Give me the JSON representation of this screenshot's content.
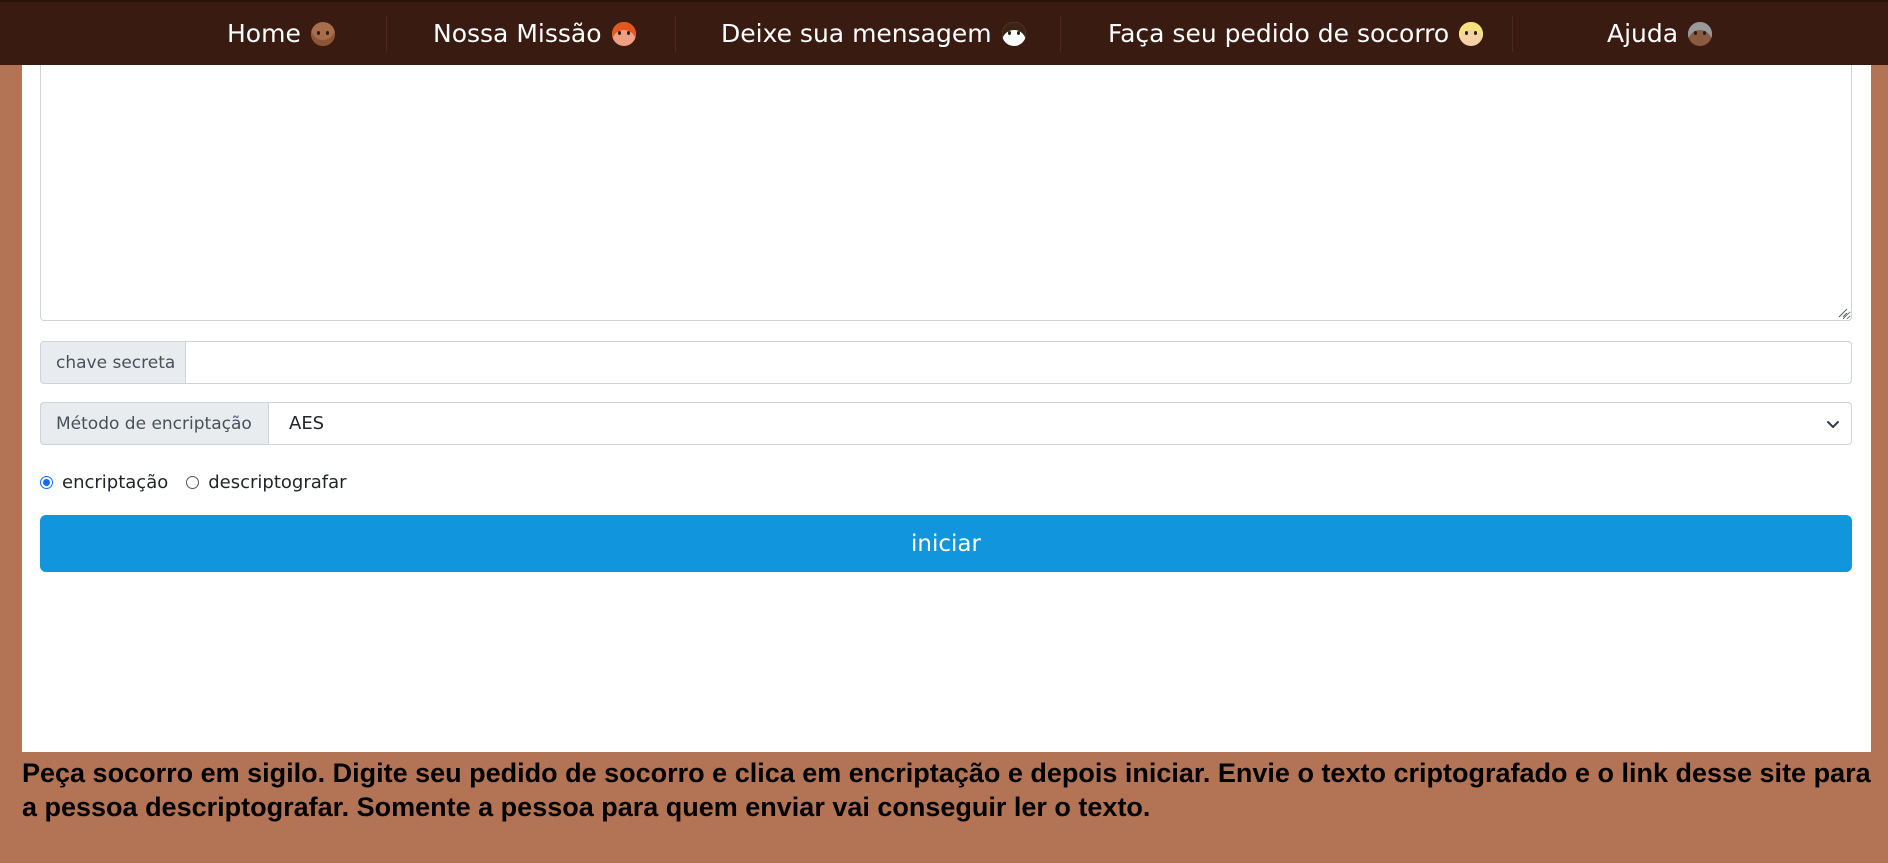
{
  "nav": {
    "items": [
      {
        "label": "Home",
        "icon": "woman-face-medium-dark-icon"
      },
      {
        "label": "Nossa Missão",
        "icon": "woman-red-hair-icon"
      },
      {
        "label": "Deixe sua mensagem",
        "icon": "sheep-face-icon"
      },
      {
        "label": "Faça seu pedido de socorro",
        "icon": "woman-blond-hair-icon"
      },
      {
        "label": "Ajuda",
        "icon": "old-woman-face-icon"
      }
    ],
    "background": "#3a1b12"
  },
  "form": {
    "message_value": "",
    "secret_key": {
      "label": "chave secreta",
      "value": ""
    },
    "method": {
      "label": "Método de encriptação",
      "selected": "AES"
    },
    "mode": {
      "options": [
        "encriptação",
        "descriptografar"
      ],
      "selected": "encriptação"
    },
    "start_label": "iniciar"
  },
  "footer_text": "Peça socorro em sigilo. Digite seu pedido de socorro e clica em encriptação e depois iniciar. Envie o texto criptografado e o link desse site para a pessoa descriptografar. Somente a pessoa para quem enviar vai conseguir ler o texto.",
  "colors": {
    "page_background": "#b37355",
    "primary_button": "#1195dc",
    "panel": "#ffffff"
  }
}
